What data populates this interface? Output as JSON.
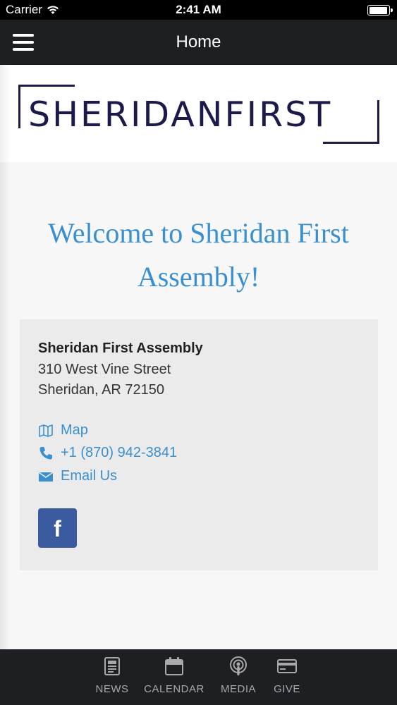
{
  "status_bar": {
    "carrier": "Carrier",
    "time": "2:41 AM"
  },
  "nav": {
    "title": "Home"
  },
  "logo": {
    "text": "SHERIDANFIRST"
  },
  "welcome": {
    "heading": "Welcome to Sheridan First Assembly!"
  },
  "contact": {
    "name": "Sheridan First Assembly",
    "address_line1": "310 West Vine Street",
    "address_line2": "Sheridan, AR 72150",
    "map_label": "Map",
    "phone_label": "+1 (870) 942-3841",
    "email_label": "Email Us",
    "facebook_glyph": "f"
  },
  "tabs": [
    {
      "label": "NEWS",
      "icon": "news-icon"
    },
    {
      "label": "CALENDAR",
      "icon": "calendar-icon"
    },
    {
      "label": "MEDIA",
      "icon": "podcast-icon"
    },
    {
      "label": "GIVE",
      "icon": "credit-card-icon"
    }
  ],
  "colors": {
    "nav_background": "#1e1f23",
    "link_blue": "#3a8fd0",
    "logo_navy": "#1c1a4a",
    "facebook_blue": "#3b5ba0"
  }
}
